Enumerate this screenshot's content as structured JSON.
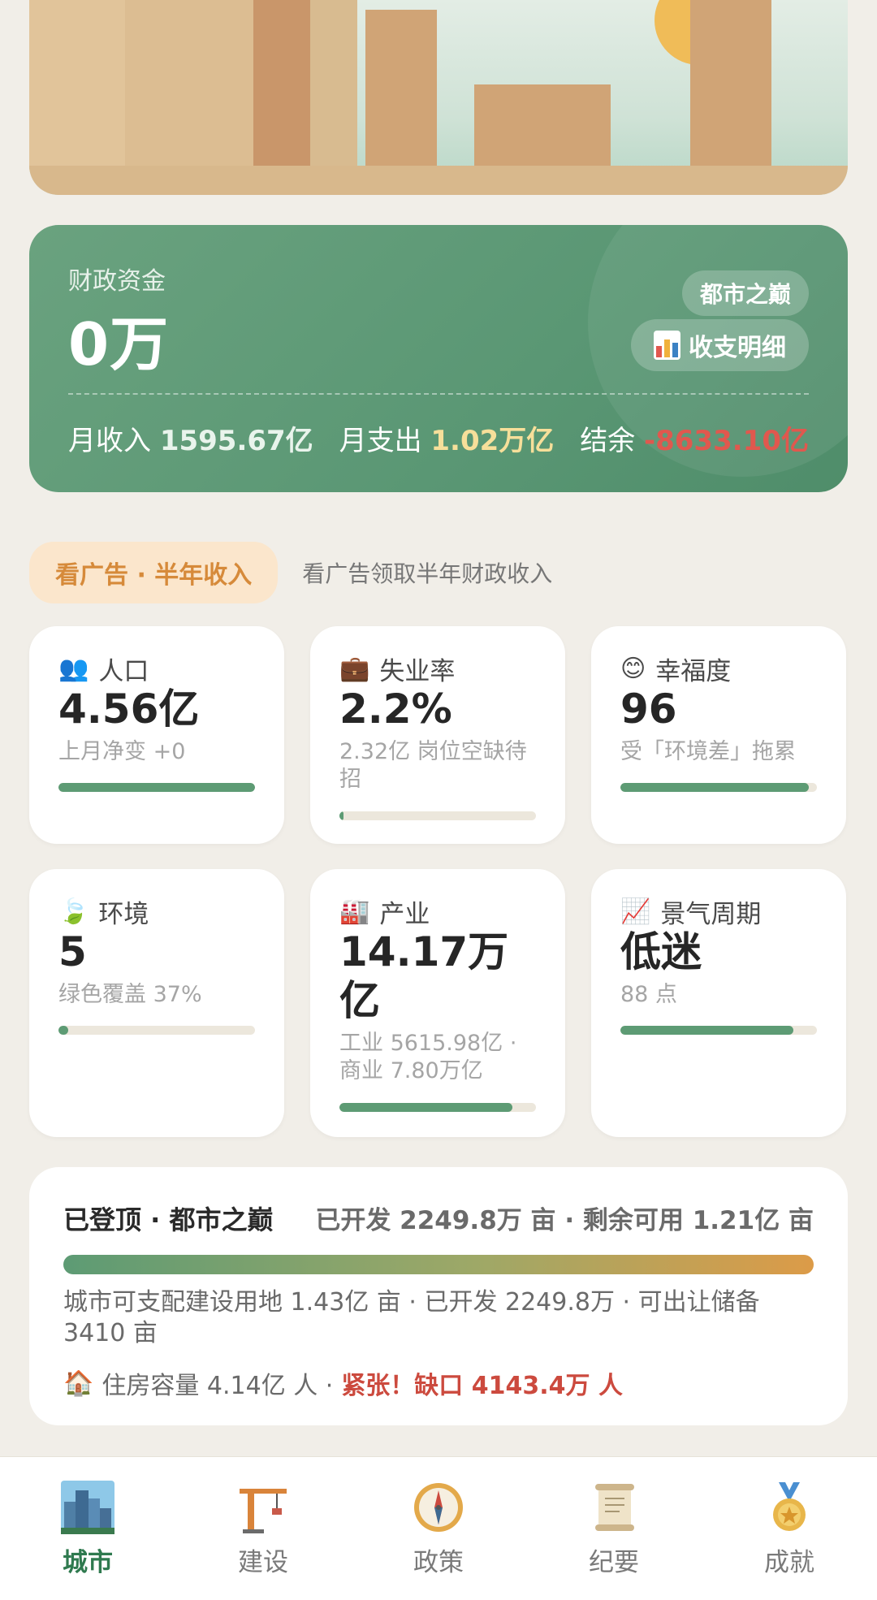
{
  "finance": {
    "label": "财政资金",
    "amount": "0万",
    "tier_badge": "都市之巅",
    "detail_button": "收支明细",
    "income_label": "月收入",
    "income_value": "1595.67亿",
    "expense_label": "月支出",
    "expense_value": "1.02万亿",
    "balance_label": "结余",
    "balance_value": "-8633.10亿"
  },
  "ad": {
    "button": "看广告 · 半年收入",
    "description": "看广告领取半年财政收入"
  },
  "stats": {
    "population": {
      "label": "人口",
      "value": "4.56亿",
      "sub": "上月净变 +0",
      "level": 1.0
    },
    "unemployment": {
      "label": "失业率",
      "value": "2.2%",
      "sub": "2.32亿 岗位空缺待招",
      "level": 0.022
    },
    "happiness": {
      "label": "幸福度",
      "value": "96",
      "sub": "受「环境差」拖累",
      "level": 0.96
    },
    "environment": {
      "label": "环境",
      "value": "5",
      "sub": "绿色覆盖 37%",
      "level": 0.05
    },
    "industry": {
      "label": "产业",
      "value": "14.17万亿",
      "sub": "工业 5615.98亿 · 商业 7.80万亿",
      "level": 0.88
    },
    "cycle": {
      "label": "景气周期",
      "value": "低迷",
      "sub": "88 点",
      "level": 0.88
    }
  },
  "land": {
    "title": "已登顶 · 都市之巅",
    "stat": "已开发 2249.8万 亩 · 剩余可用 1.21亿 亩",
    "description": "城市可支配建设用地 1.43亿 亩 · 已开发 2249.8万 · 可出让储备 3410 亩",
    "housing_text": "住房容量 4.14亿 人 ·",
    "housing_warning": "紧张！缺口 4143.4万 人"
  },
  "nav": {
    "city": "城市",
    "build": "建设",
    "policy": "政策",
    "records": "纪要",
    "achievements": "成就",
    "active": "city"
  },
  "colors": {
    "finance_card": "#5a9774",
    "accent_green": "#5d9b74",
    "expense_yellow": "#f6df9a",
    "balance_red": "#e0584e",
    "ad_orange": "#d68a3a",
    "warning_red": "#cc4a3e"
  }
}
